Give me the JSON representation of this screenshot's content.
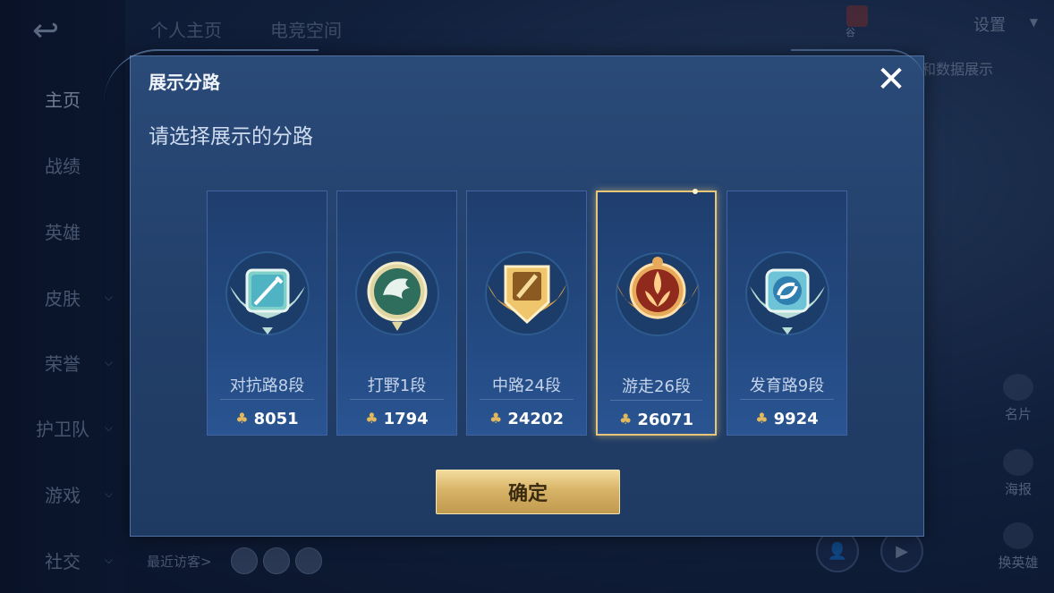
{
  "background": {
    "tabs": [
      "个人主页",
      "电竞空间"
    ],
    "settings_label": "设置",
    "gift_label": "谷",
    "data_display_label": "和数据展示",
    "nav": [
      {
        "label": "主页",
        "chevron": false
      },
      {
        "label": "战绩",
        "chevron": false
      },
      {
        "label": "英雄",
        "chevron": false
      },
      {
        "label": "皮肤",
        "chevron": true
      },
      {
        "label": "荣誉",
        "chevron": true
      },
      {
        "label": "护卫队",
        "chevron": true
      },
      {
        "label": "游戏",
        "chevron": true
      },
      {
        "label": "社交",
        "chevron": true
      }
    ],
    "side_buttons": [
      "名片",
      "海报",
      "换英雄"
    ],
    "recent_visitors_label": "最近访客>"
  },
  "dialog": {
    "title": "展示分路",
    "close_icon": "close-icon",
    "subtitle": "请选择展示的分路",
    "cards": [
      {
        "name": "对抗路8段",
        "score": "8051",
        "badge_color": "#7fd0c8",
        "badge_icon": "sword-icon",
        "selected": false
      },
      {
        "name": "打野1段",
        "score": "1794",
        "badge_color": "#6fae9a",
        "badge_icon": "dragon-icon",
        "selected": false
      },
      {
        "name": "中路24段",
        "score": "24202",
        "badge_color": "#d9a24a",
        "badge_icon": "staff-icon",
        "selected": false
      },
      {
        "name": "游走26段",
        "score": "26071",
        "badge_color": "#c8582f",
        "badge_icon": "shield-flame-icon",
        "selected": true
      },
      {
        "name": "发育路9段",
        "score": "9924",
        "badge_color": "#6ec4d6",
        "badge_icon": "arrow-icon",
        "selected": false
      }
    ],
    "confirm_label": "确定"
  }
}
